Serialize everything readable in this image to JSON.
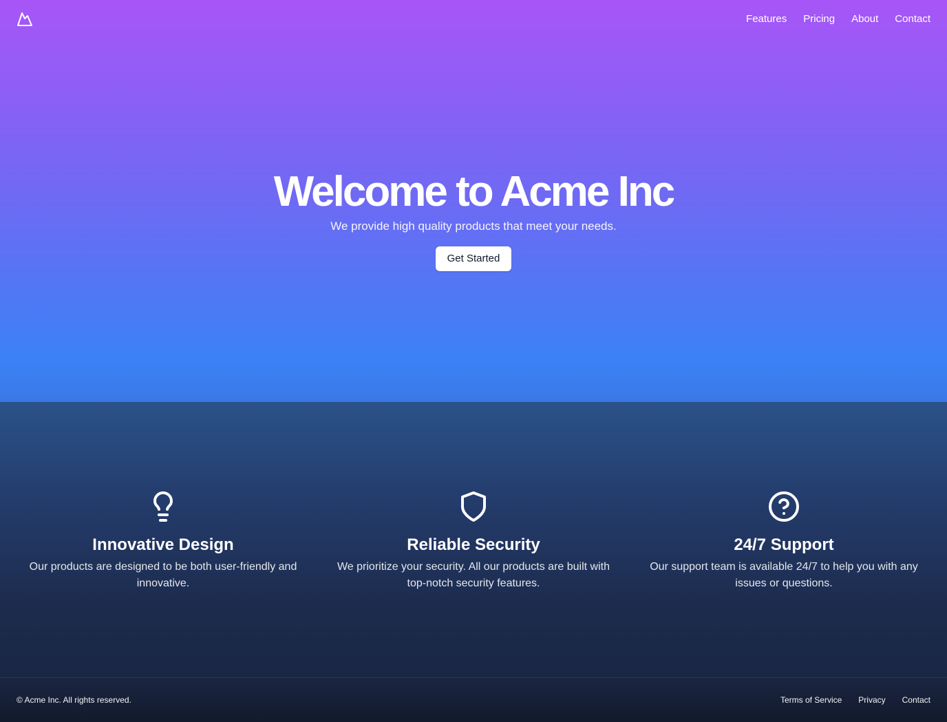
{
  "header": {
    "logo_icon": "mountain-logo-icon",
    "nav": [
      {
        "label": "Features"
      },
      {
        "label": "Pricing"
      },
      {
        "label": "About"
      },
      {
        "label": "Contact"
      }
    ]
  },
  "hero": {
    "title": "Welcome to Acme Inc",
    "subtitle": "We provide high quality products that meet your needs.",
    "cta_label": "Get Started",
    "gradient_top": "#a855f7",
    "gradient_bottom": "#3b82f6"
  },
  "features": [
    {
      "icon": "lightbulb-icon",
      "title": "Innovative Design",
      "description": "Our products are designed to be both user-friendly and innovative."
    },
    {
      "icon": "shield-icon",
      "title": "Reliable Security",
      "description": "We prioritize your security. All our products are built with top-notch security features."
    },
    {
      "icon": "help-circle-icon",
      "title": "24/7 Support",
      "description": "Our support team is available 24/7 to help you with any issues or questions."
    }
  ],
  "footer": {
    "copyright": "© Acme Inc. All rights reserved.",
    "links": [
      {
        "label": "Terms of Service"
      },
      {
        "label": "Privacy"
      },
      {
        "label": "Contact"
      }
    ]
  }
}
